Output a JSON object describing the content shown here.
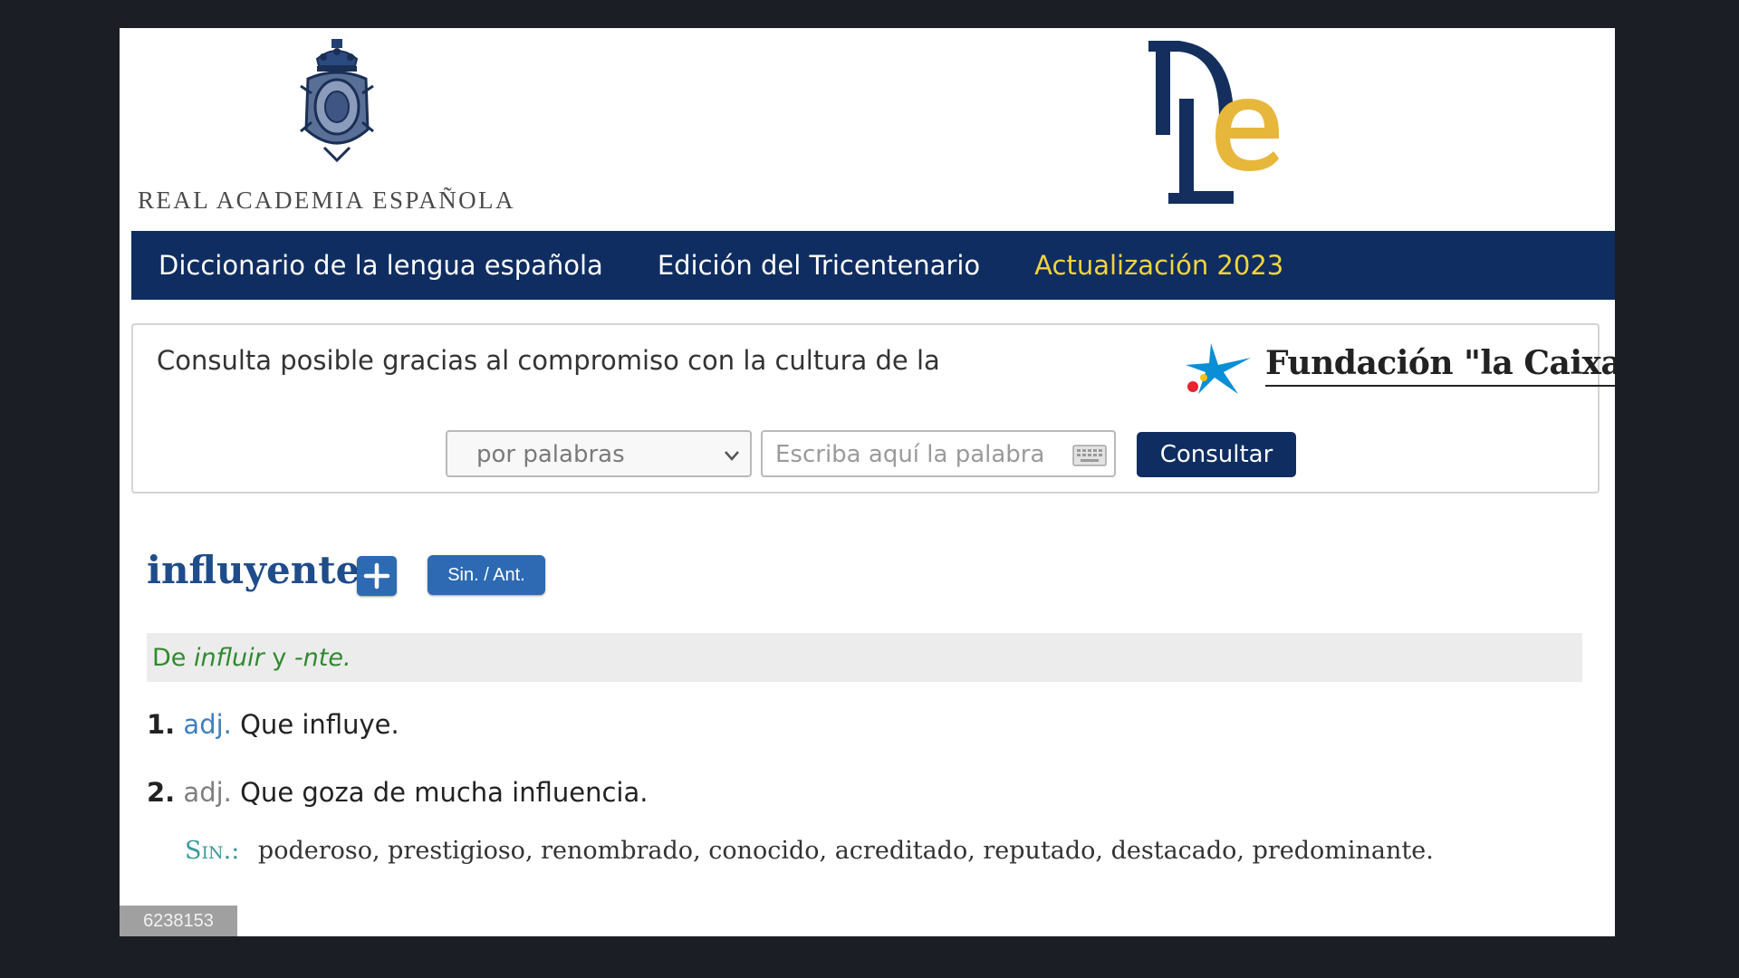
{
  "header": {
    "institution_name": "REAL ACADEMIA ESPAÑOLA",
    "dle_logo_text": "DLE"
  },
  "nav": {
    "items": [
      {
        "label": "Diccionario de la lengua española"
      },
      {
        "label": "Edición del Tricentenario"
      },
      {
        "label": "Actualización 2023"
      }
    ]
  },
  "sponsor": {
    "text": "Consulta posible gracias al compromiso con la cultura de la",
    "name": "Fundación \"la Caixa\""
  },
  "search": {
    "mode_selected": "por palabras",
    "placeholder": "Escriba aquí la palabra",
    "value": "",
    "button_label": "Consultar"
  },
  "entry": {
    "headword": "influyente",
    "syn_ant_button": "Sin. / Ant.",
    "etymology": {
      "prefix": "De ",
      "term1": "influir",
      "mid": " y ",
      "term2": "-nte."
    },
    "definitions": [
      {
        "num": "1.",
        "category": "adj.",
        "text": "Que influye."
      },
      {
        "num": "2.",
        "category": "adj.",
        "text": "Que goza de mucha influencia."
      }
    ],
    "synonyms_label": "Sin.:",
    "synonyms": "poderoso, prestigioso, renombrado, conocido, acreditado, reputado, destacado, predominante."
  },
  "footer": {
    "page_id": "6238153"
  },
  "colors": {
    "nav_bg": "#0f2d60",
    "nav_accent": "#f2d43b",
    "headword": "#1f4c8a",
    "etymology_green": "#2f8a2f",
    "button_blue": "#2d6ab3"
  }
}
